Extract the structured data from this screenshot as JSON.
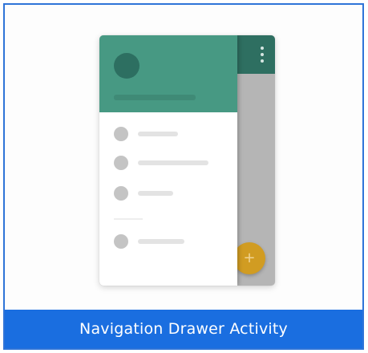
{
  "template": {
    "title": "Navigation Drawer Activity",
    "selected": true
  },
  "preview": {
    "icons": {
      "overflow": "more-vert-icon",
      "fab": "add-icon"
    },
    "fab_symbol": "+",
    "menu_items": [
      "item-1",
      "item-2",
      "item-3",
      "item-4"
    ]
  },
  "colors": {
    "selection_border": "#2f74d8",
    "caption_background": "#1a6ee0",
    "app_bar": "#2e6f61",
    "drawer_header": "#479983",
    "fab": "#d19c22"
  }
}
